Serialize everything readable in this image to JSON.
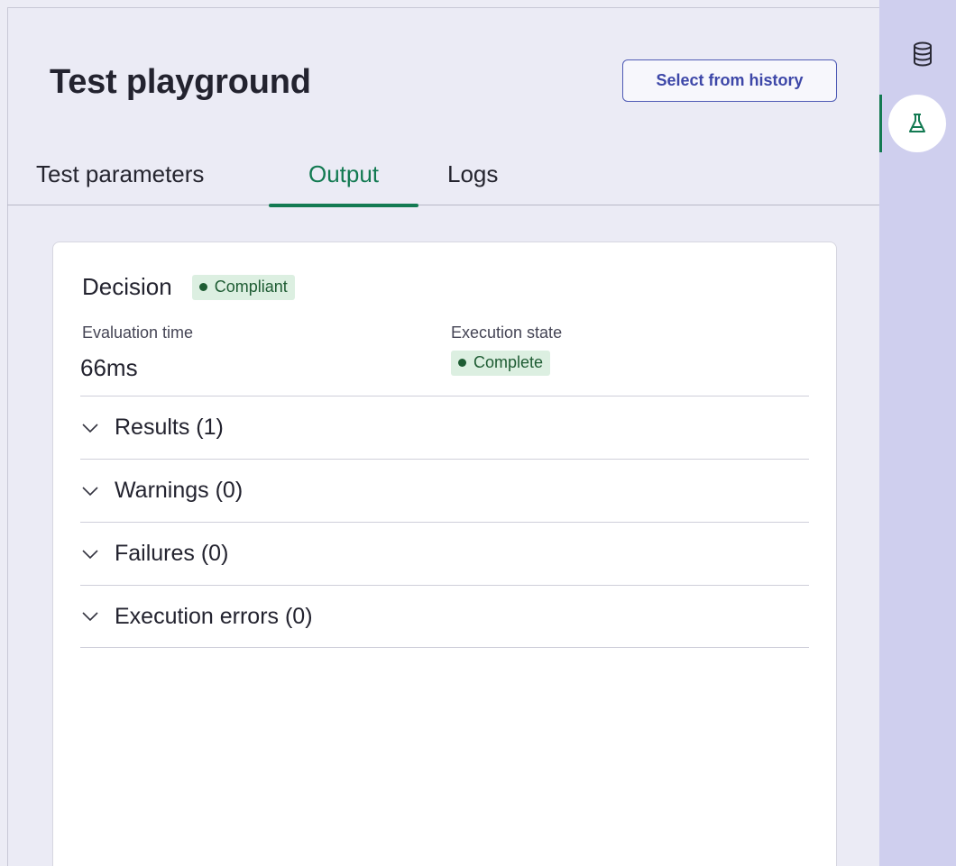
{
  "header": {
    "title": "Test playground",
    "history_button": "Select from history"
  },
  "tabs": [
    {
      "label": "Test parameters",
      "active": false
    },
    {
      "label": "Output",
      "active": true
    },
    {
      "label": "Logs",
      "active": false
    }
  ],
  "output": {
    "decision_label": "Decision",
    "decision_badge": "Compliant",
    "evaluation_time_label": "Evaluation time",
    "evaluation_time_value": "66ms",
    "execution_state_label": "Execution state",
    "execution_state_badge": "Complete",
    "sections": [
      {
        "label": "Results (1)"
      },
      {
        "label": "Warnings (0)"
      },
      {
        "label": "Failures (0)"
      },
      {
        "label": "Execution errors (0)"
      }
    ]
  },
  "rail": {
    "items": [
      {
        "icon": "database-icon",
        "active": false
      },
      {
        "icon": "flask-icon",
        "active": true
      }
    ]
  },
  "colors": {
    "accent": "#137a52",
    "badge_bg": "#dcefe1",
    "badge_text": "#1e5c33",
    "button_border": "#4f5bb5",
    "rail_bg": "#cfcfee"
  }
}
